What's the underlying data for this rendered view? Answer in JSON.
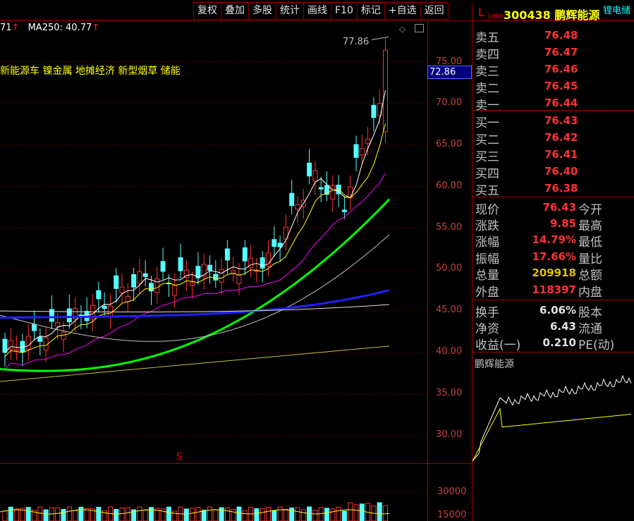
{
  "toolbar": {
    "buttons": [
      "复权",
      "叠加",
      "多股",
      "统计",
      "画线",
      "F10",
      "标记",
      "+自选",
      "返回"
    ]
  },
  "ma_header": {
    "prefix": "71",
    "ma250_label": "MA250: 40.77"
  },
  "concepts": "新能源车 镍金属 地摊经济 新型烟草 储能",
  "peak_label": "77.86",
  "current_price_tag": "72.86",
  "price_axis": [
    "75.00",
    "70.00",
    "65.00",
    "60.00",
    "55.00",
    "50.00",
    "45.00",
    "40.00",
    "35.00",
    "30.00"
  ],
  "volume_axis": [
    "30000",
    "15000"
  ],
  "s_mark": "S",
  "quote": {
    "l_mark": "L",
    "l_sub": "1000",
    "code": "300438",
    "name": "鹏辉能源",
    "tag": "锂电储"
  },
  "order_book": {
    "asks": [
      {
        "label": "卖五",
        "price": "76.48"
      },
      {
        "label": "卖四",
        "price": "76.47"
      },
      {
        "label": "卖三",
        "price": "76.46"
      },
      {
        "label": "卖二",
        "price": "76.45"
      },
      {
        "label": "卖一",
        "price": "76.44"
      }
    ],
    "bids": [
      {
        "label": "买一",
        "price": "76.43"
      },
      {
        "label": "买二",
        "price": "76.42"
      },
      {
        "label": "买三",
        "price": "76.41"
      },
      {
        "label": "买四",
        "price": "76.40"
      },
      {
        "label": "买五",
        "price": "76.38"
      }
    ]
  },
  "stats": [
    {
      "label": "现价",
      "value": "76.43",
      "label2": "今开",
      "color": "#ff3232"
    },
    {
      "label": "涨跌",
      "value": "9.85",
      "label2": "最高",
      "color": "#ff3232"
    },
    {
      "label": "涨幅",
      "value": "14.79%",
      "label2": "最低",
      "color": "#ff3232"
    },
    {
      "label": "振幅",
      "value": "17.66%",
      "label2": "量比",
      "color": "#ff3232"
    },
    {
      "label": "总量",
      "value": "209918",
      "label2": "总额",
      "color": "#e0c000"
    },
    {
      "label": "外盘",
      "value": "118397",
      "label2": "内盘",
      "color": "#ff3232"
    },
    {
      "label": "换手",
      "value": "6.06%",
      "label2": "股本",
      "color": "#e0e0e0"
    },
    {
      "label": "净资",
      "value": "6.43",
      "label2": "流通",
      "color": "#e0e0e0"
    },
    {
      "label": "收益(一)",
      "value": "0.210",
      "label2": "PE(动)",
      "color": "#e0e0e0"
    }
  ],
  "mini_chart_title": "鹏辉能源",
  "colors": {
    "up": "#ff3232",
    "down": "#54ffff",
    "ma5": "#ffffff",
    "ma10": "#ffff00",
    "ma20": "#ff00ff",
    "ma60": "#00ff00",
    "ma120": "#c0c0c0",
    "ma_blue": "#2020ff",
    "ma250": "#c0c040",
    "grid": "#a00000"
  }
}
